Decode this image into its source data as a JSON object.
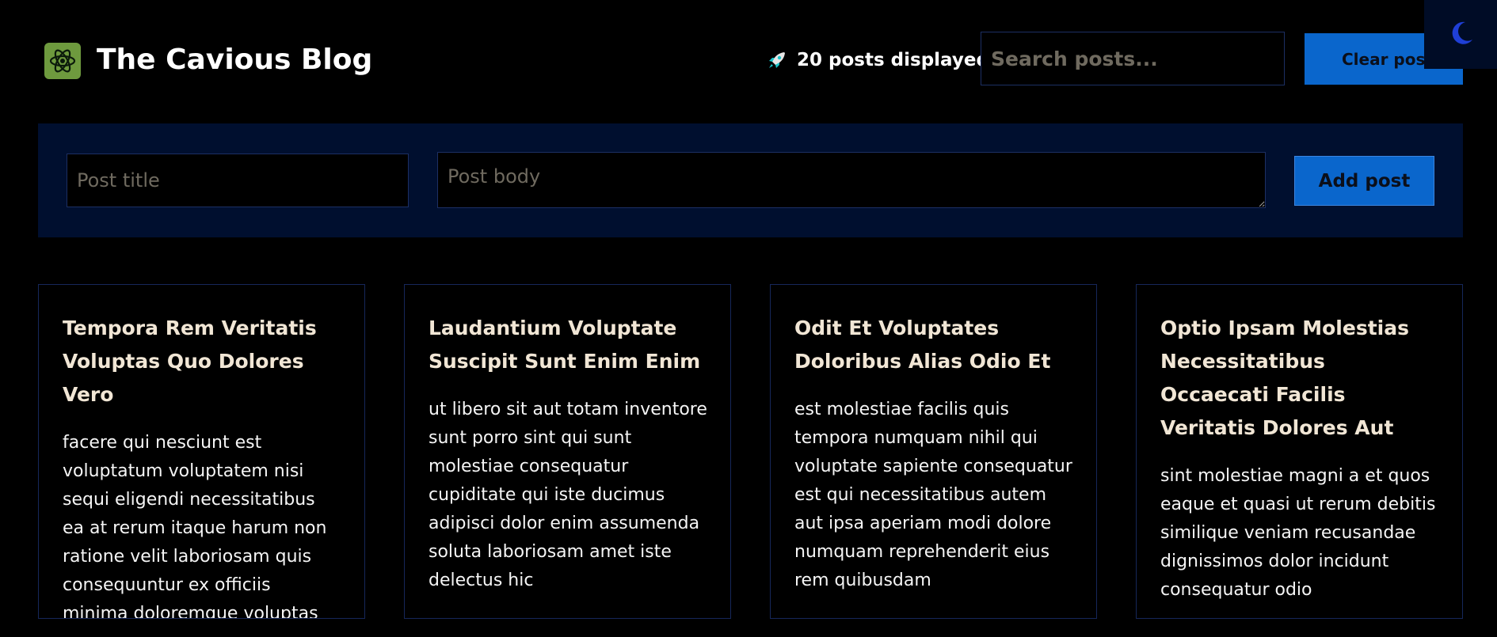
{
  "header": {
    "title": "The Cavious Blog",
    "logo_icon": "atom-icon",
    "logo_color": "#6e9a3e",
    "post_count_icon": "rocket-icon",
    "post_count_text": "20 posts displayed",
    "search_placeholder": "Search posts...",
    "clear_label": "Clear posts",
    "theme_toggle_icon": "moon-icon"
  },
  "compose": {
    "title_placeholder": "Post title",
    "body_placeholder": "Post body",
    "add_label": "Add post"
  },
  "posts": [
    {
      "title": "Tempora Rem Veritatis Voluptas Quo Dolores Vero",
      "body": "facere qui nesciunt est voluptatum voluptatem nisi sequi eligendi necessitatibus ea at rerum itaque harum non ratione velit laboriosam quis consequuntur ex officiis minima doloremque voluptas ut aut"
    },
    {
      "title": "Laudantium Voluptate Suscipit Sunt Enim Enim",
      "body": "ut libero sit aut totam inventore sunt porro sint qui sunt molestiae consequatur cupiditate qui iste ducimus adipisci dolor enim assumenda soluta laboriosam amet iste delectus hic"
    },
    {
      "title": "Odit Et Voluptates Doloribus Alias Odio Et",
      "body": "est molestiae facilis quis tempora numquam nihil qui voluptate sapiente consequatur est qui necessitatibus autem aut ipsa aperiam modi dolore numquam reprehenderit eius rem quibusdam"
    },
    {
      "title": "Optio Ipsam Molestias Necessitatibus Occaecati Facilis Veritatis Dolores Aut",
      "body": "sint molestiae magni a et quos eaque et quasi ut rerum debitis similique veniam recusandae dignissimos dolor incidunt consequatur odio"
    }
  ],
  "colors": {
    "accent": "#0a66cc",
    "compose_background": "#000f2f",
    "card_border": "#16275a",
    "title_text": "#f1e6d5"
  }
}
